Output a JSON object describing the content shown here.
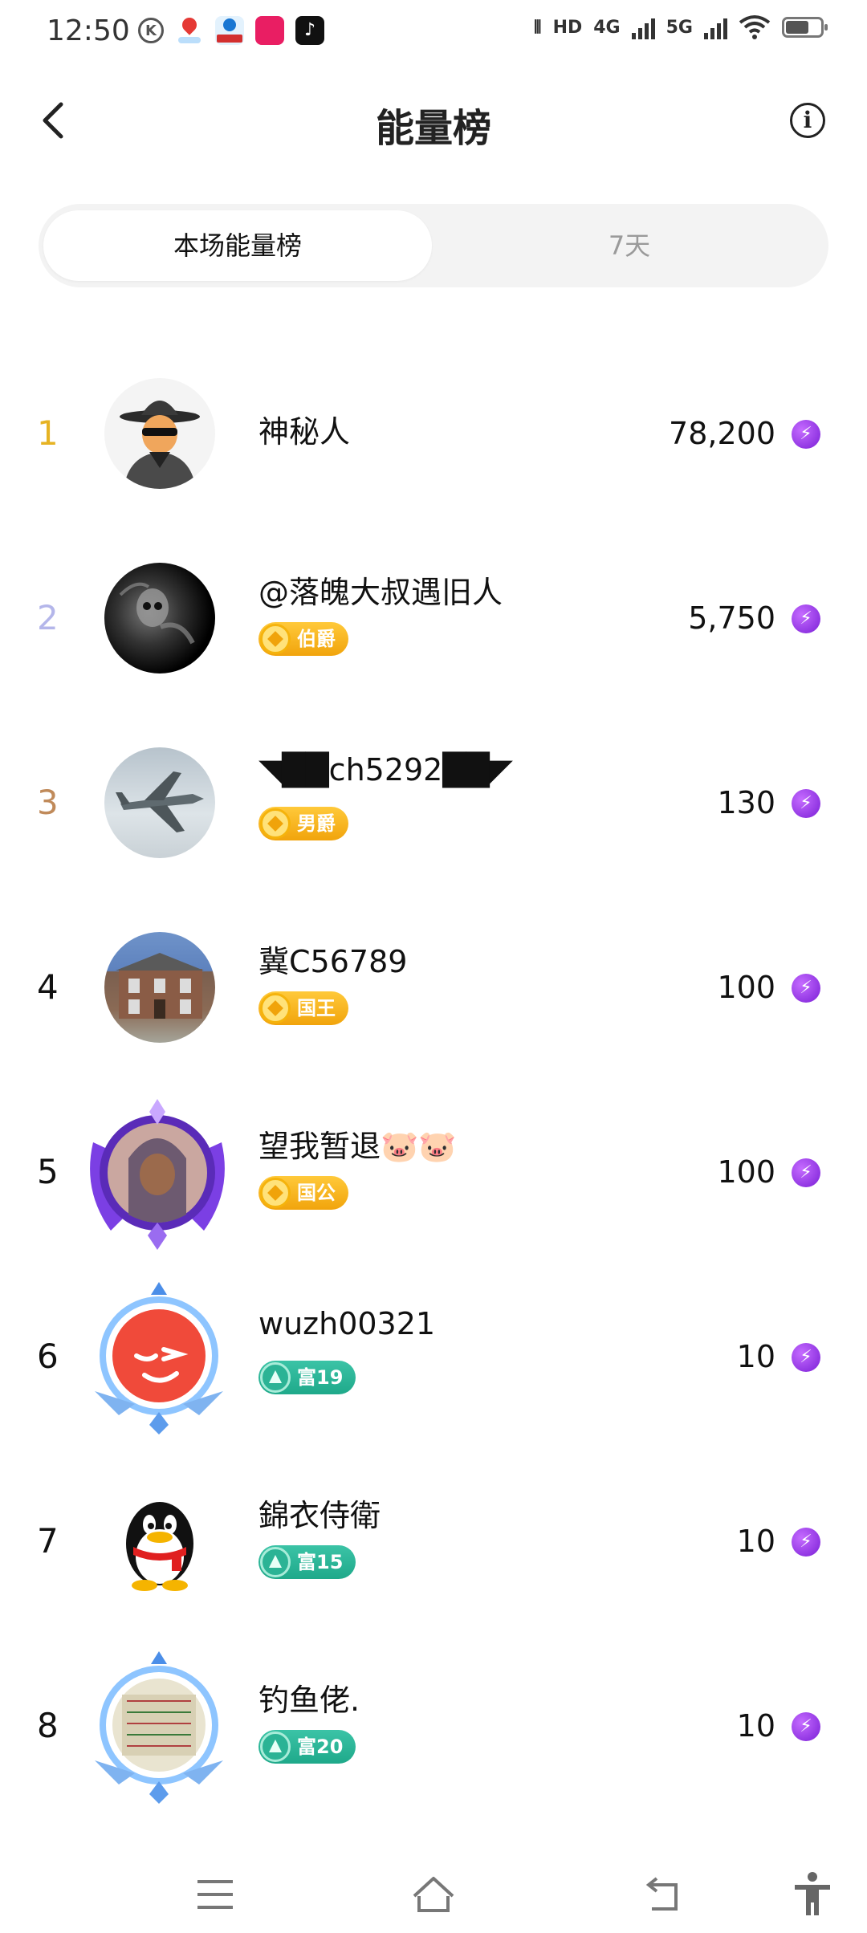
{
  "status_bar": {
    "time": "12:50",
    "notification_icons": [
      "k-icon",
      "map-pin-icon",
      "weather-app-icon",
      "red-app-icon",
      "tiktok-icon"
    ],
    "hd_label": "HD",
    "net1": "4G",
    "net2": "5G"
  },
  "header": {
    "title": "能量榜"
  },
  "tabs": [
    {
      "label": "本场能量榜",
      "active": true
    },
    {
      "label": "7天",
      "active": false
    }
  ],
  "ranking": [
    {
      "rank": "1",
      "name": "神秘人",
      "badge": "",
      "score": "78,200"
    },
    {
      "rank": "2",
      "name": "@落魄大叔遇旧人",
      "badge": "伯爵",
      "score": "5,750"
    },
    {
      "rank": "3",
      "name": "◥██ch5292██◤",
      "badge": "男爵",
      "score": "130"
    },
    {
      "rank": "4",
      "name": "冀C56789",
      "badge": "国王",
      "score": "100"
    },
    {
      "rank": "5",
      "name": "望我暂退🐷🐷",
      "badge": "国公",
      "score": "100"
    },
    {
      "rank": "6",
      "name": "wuzh00321",
      "badge": "富19",
      "score": "10"
    },
    {
      "rank": "7",
      "name": "錦衣侍衛",
      "badge": "富15",
      "score": "10"
    },
    {
      "rank": "8",
      "name": "钓鱼佬.",
      "badge": "富20",
      "score": "10"
    }
  ],
  "colors": {
    "rank1": "#e6b323",
    "rank2": "#b4b6ea",
    "rank3": "#c08a5a",
    "noble_badge": "#f1a40c",
    "wealth_badge": "#1fa98a",
    "energy_icon": "#8a2be2"
  }
}
